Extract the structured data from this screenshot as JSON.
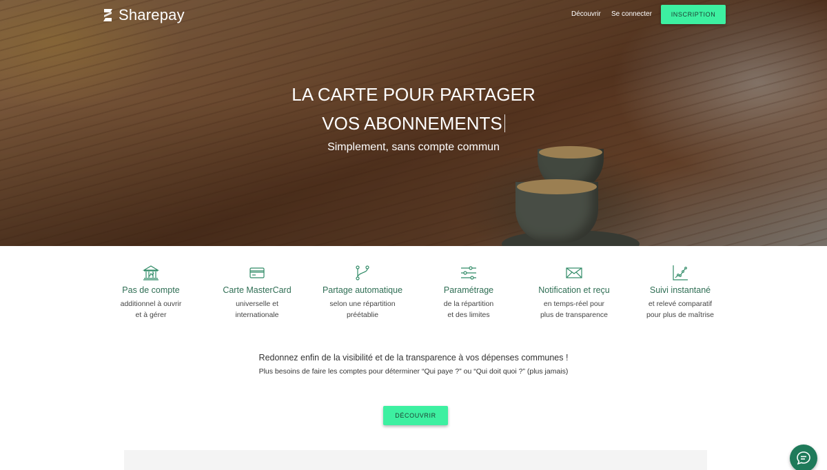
{
  "brand": {
    "name": "Sharepay"
  },
  "nav": {
    "discover": "Découvrir",
    "login": "Se connecter",
    "signup": "INSCRIPTION"
  },
  "hero": {
    "title_line1": "LA CARTE POUR PARTAGER",
    "title_line2": "VOS ABONNEMENTS",
    "subtitle": "Simplement, sans compte commun"
  },
  "features": [
    {
      "icon": "bank-icon",
      "title": "Pas de compte",
      "desc1": "additionnel à ouvrir",
      "desc2": "et à gérer"
    },
    {
      "icon": "credit-card-icon",
      "title": "Carte MasterCard",
      "desc1": "universelle et",
      "desc2": "internationale"
    },
    {
      "icon": "split-icon",
      "title": "Partage automatique",
      "desc1": "selon une répartition",
      "desc2": "préétablie"
    },
    {
      "icon": "sliders-icon",
      "title": "Paramétrage",
      "desc1": "de la répartition",
      "desc2": "et des limites"
    },
    {
      "icon": "envelope-icon",
      "title": "Notification et reçu",
      "desc1": "en temps-réel pour",
      "desc2": "plus de transparence"
    },
    {
      "icon": "line-chart-icon",
      "title": "Suivi instantané",
      "desc1": "et relevé comparatif",
      "desc2": "pour plus de maîtrise"
    }
  ],
  "tagline": "Redonnez enfin de la visibilité et de la transparence à vos dépenses communes !",
  "subtagline": "Plus besoins de faire les comptes pour déterminer “Qui paye ?” ou “Qui doit quoi ?” (plus jamais)",
  "cta": {
    "discover": "DÉCOUVRIR"
  },
  "colors": {
    "accent": "#3df0a1",
    "feature_text": "#2f6e54",
    "chat": "#1f7a5a"
  }
}
